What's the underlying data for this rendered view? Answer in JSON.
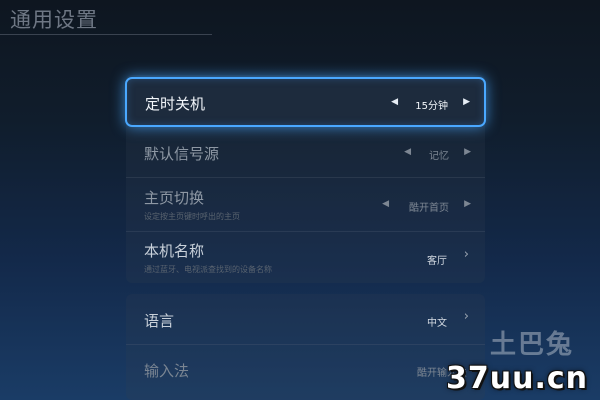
{
  "header": {
    "title": "通用设置"
  },
  "settings": {
    "timer": {
      "label": "定时关机",
      "value": "15分钟",
      "left": "◀",
      "right": "▶"
    },
    "source": {
      "label": "默认信号源",
      "value": "记忆",
      "left": "◀",
      "right": "▶"
    },
    "home": {
      "label": "主页切换",
      "sub": "设定按主页键时呼出的主页",
      "value": "酷开首页",
      "left": "◀",
      "right": "▶"
    },
    "name": {
      "label": "本机名称",
      "sub": "通过蓝牙、电视派查找到的设备名称",
      "value": "客厅",
      "chevron": "›"
    },
    "language": {
      "label": "语言",
      "value": "中文",
      "chevron": "›"
    },
    "ime": {
      "label": "输入法",
      "value": "酷开输入法"
    }
  },
  "watermark": {
    "top": "土巴兔",
    "main": "37uu.cn"
  }
}
